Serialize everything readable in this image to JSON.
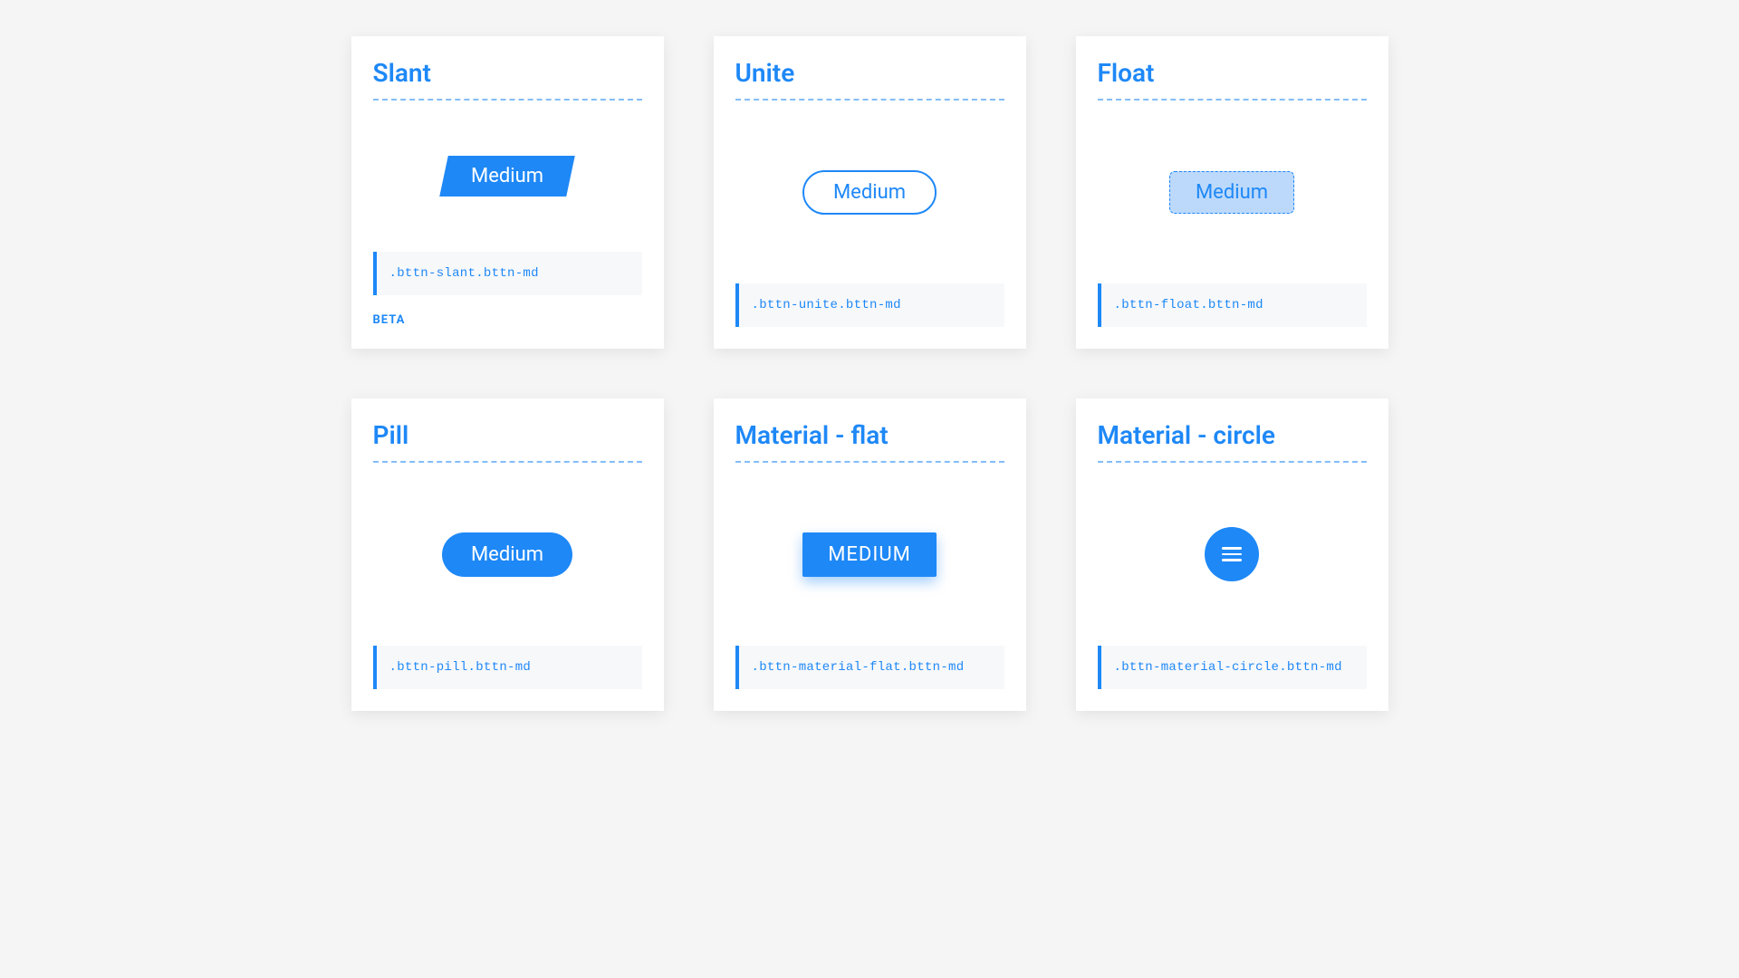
{
  "cards": [
    {
      "title": "Slant",
      "button_label": "Medium",
      "code": ".bttn-slant.bttn-md",
      "badge": "BETA"
    },
    {
      "title": "Unite",
      "button_label": "Medium",
      "code": ".bttn-unite.bttn-md"
    },
    {
      "title": "Float",
      "button_label": "Medium",
      "code": ".bttn-float.bttn-md"
    },
    {
      "title": "Pill",
      "button_label": "Medium",
      "code": ".bttn-pill.bttn-md"
    },
    {
      "title": "Material - flat",
      "button_label": "MEDIUM",
      "code": ".bttn-material-flat.bttn-md"
    },
    {
      "title": "Material - circle",
      "button_label": "",
      "code": ".bttn-material-circle.bttn-md"
    }
  ],
  "colors": {
    "primary": "#1e88f7",
    "float_bg": "#bcd9fb"
  }
}
